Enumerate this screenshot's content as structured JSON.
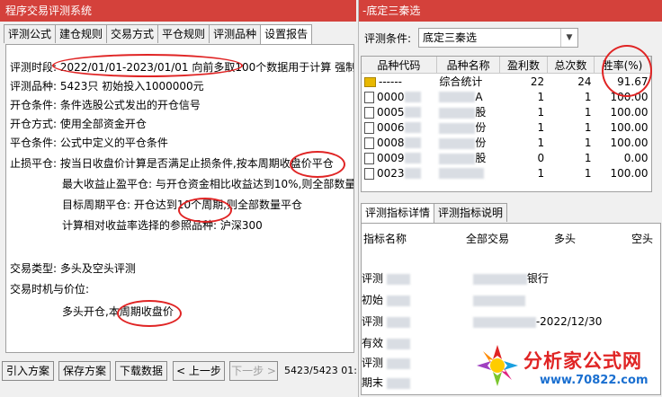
{
  "left_window": {
    "title": "程序交易评测系统",
    "tabs": [
      "评测公式",
      "建仓规则",
      "交易方式",
      "平仓规则",
      "评测品种",
      "设置报告"
    ],
    "report": {
      "period_label": "评测时段:",
      "period_value": "2022/01/01-2023/01/01 向前多取100个数据用于计算 强制平仓",
      "variety_label": "评测品种:",
      "variety_value": "5423只 初始投入1000000元",
      "open_cond_label": "开仓条件:",
      "open_cond_value": "条件选股公式发出的开仓信号",
      "open_mode_label": "开仓方式:",
      "open_mode_value": "使用全部资金开仓",
      "close_cond_label": "平仓条件:",
      "close_cond_value": "公式中定义的平仓条件",
      "stop_label": "止损平仓:",
      "stop_value": "按当日收盘价计算是否满足止损条件,按本周期收盘价平仓",
      "max_profit": "最大收益止盈平仓: 与开仓资金相比收益达到10%,则全部数量平仓",
      "target_period": "目标周期平仓: 开仓达到10个周期,则全部数量平仓",
      "reference": "计算相对收益率选择的参照品种: 沪深300",
      "trade_type_label": "交易类型:",
      "trade_type_value": "多头及空头评测",
      "timing_label": "交易时机与价位:",
      "timing_value": "多头开仓,本周期收盘价"
    },
    "buttons": {
      "import": "引入方案",
      "save": "保存方案",
      "download": "下载数据",
      "prev": "< 上一步",
      "next": "下一步 >",
      "status": "5423/5423 01:"
    }
  },
  "right_window": {
    "title": "-底定三秦选",
    "condition_label": "评测条件:",
    "condition_value": "底定三秦选",
    "grid": {
      "headers": [
        "品种代码",
        "品种名称",
        "盈利数",
        "总次数",
        "胜率(%)"
      ],
      "rows": [
        {
          "code": "------",
          "name": "综合统计",
          "profit": "22",
          "total": "24",
          "rate": "91.67",
          "icon": "folder-icon"
        },
        {
          "code": "0000",
          "name": "A",
          "profit": "1",
          "total": "1",
          "rate": "100.00",
          "icon": "file-icon"
        },
        {
          "code": "0005",
          "name": "股",
          "profit": "1",
          "total": "1",
          "rate": "100.00",
          "icon": "file-icon"
        },
        {
          "code": "0006",
          "name": "份",
          "profit": "1",
          "total": "1",
          "rate": "100.00",
          "icon": "file-icon"
        },
        {
          "code": "0008",
          "name": "份",
          "profit": "1",
          "total": "1",
          "rate": "100.00",
          "icon": "file-icon"
        },
        {
          "code": "0009",
          "name": "股",
          "profit": "0",
          "total": "1",
          "rate": "0.00",
          "icon": "file-icon"
        },
        {
          "code": "0023",
          "name": "",
          "profit": "1",
          "total": "1",
          "rate": "100.00",
          "icon": "file-icon"
        }
      ]
    },
    "detail_tabs": [
      "评测指标详情",
      "评测指标说明"
    ],
    "detail_headers": [
      "指标名称",
      "全部交易",
      "多头",
      "空头"
    ],
    "detail_rows": [
      {
        "name": "评测",
        "value": "银行"
      },
      {
        "name": "初始",
        "value": ""
      },
      {
        "name": "评测",
        "value": "-2022/12/30"
      },
      {
        "name": "有效",
        "value": ""
      },
      {
        "name": "评测",
        "value": ""
      },
      {
        "name": "期末",
        "value": ""
      }
    ]
  },
  "watermark": {
    "text": "分析家公式网",
    "url": "www.70822.com"
  },
  "colors": {
    "title_bar": "#d4413b",
    "annotation_circle": "#e02424"
  }
}
